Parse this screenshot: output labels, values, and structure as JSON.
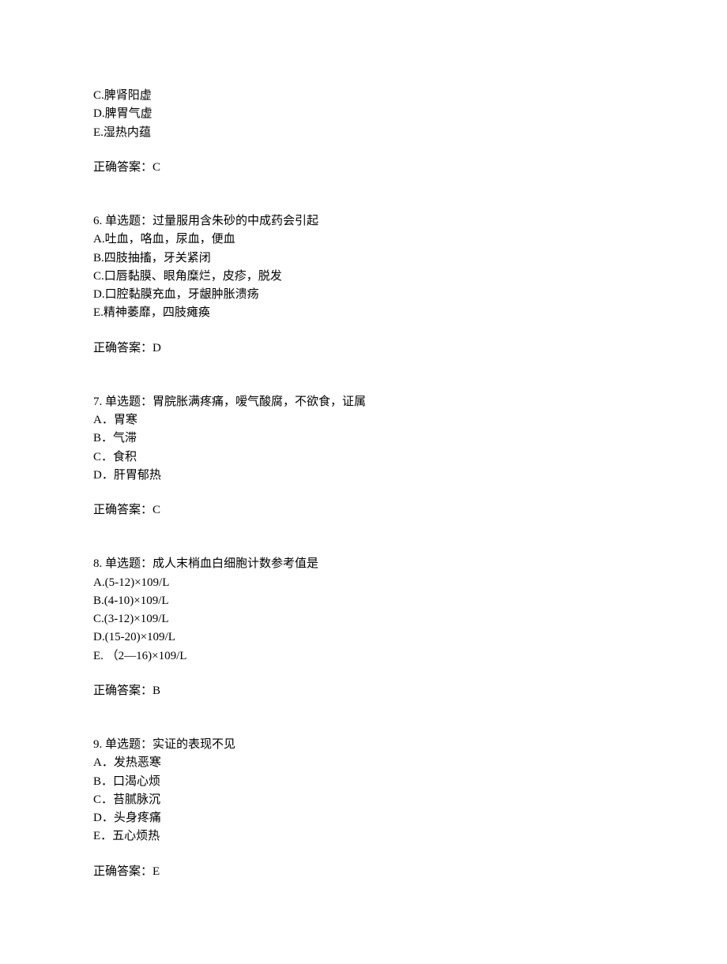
{
  "prelude_options": {
    "c": "C.脾肾阳虚",
    "d": "D.脾胃气虚",
    "e": "E.湿热内蕴"
  },
  "prelude_answer": "正确答案：C",
  "questions": [
    {
      "stem": "6. 单选题：过量服用含朱砂的中成药会引起",
      "options": [
        "A.吐血，咯血，尿血，便血",
        "B.四肢抽搐，牙关紧闭",
        "C.口唇黏膜、眼角糜烂，皮疹，脱发",
        "D.口腔黏膜充血，牙龈肿胀溃疡",
        "E.精神萎靡，四肢瘫痪"
      ],
      "answer": "正确答案：D"
    },
    {
      "stem": "7. 单选题：胃脘胀满疼痛，嗳气酸腐，不欲食，证属",
      "options": [
        "A．胃寒",
        "B．气滞",
        "C．食积",
        "D．肝胃郁热"
      ],
      "answer": "正确答案：C"
    },
    {
      "stem": "8. 单选题：成人末梢血白细胞计数参考值是",
      "options": [
        "A.(5-12)×109/L",
        "B.(4-10)×109/L",
        "C.(3-12)×109/L",
        "D.(15-20)×109/L",
        "E. （2—16)×109/L"
      ],
      "answer": "正确答案：B"
    },
    {
      "stem": "9. 单选题：实证的表现不见",
      "options": [
        "A．发热恶寒",
        "B．口渴心烦",
        "C．苔腻脉沉",
        "D．头身疼痛",
        "E．五心烦热"
      ],
      "answer": "正确答案：E"
    }
  ]
}
